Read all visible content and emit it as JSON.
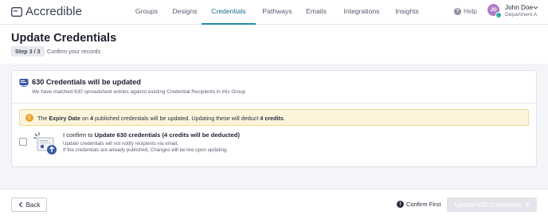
{
  "app": {
    "name": "Accredible"
  },
  "nav": {
    "items": [
      {
        "label": "Groups",
        "active": false
      },
      {
        "label": "Designs",
        "active": false
      },
      {
        "label": "Credentials",
        "active": true
      },
      {
        "label": "Pathways",
        "active": false
      },
      {
        "label": "Emails",
        "active": false
      },
      {
        "label": "Integrations",
        "active": false
      },
      {
        "label": "Insights",
        "active": false
      }
    ],
    "help": "Help"
  },
  "user": {
    "initials": "JD",
    "name": "John Doe",
    "department": "Department A"
  },
  "header": {
    "title": "Update Credentials",
    "step": "Step 3 / 3",
    "step_desc": "Confirm your records"
  },
  "card": {
    "title": "630 Credentials will be updated",
    "subtitle": "We have matched 630 spreadsheet entries against existing Credential Recipients in this Group"
  },
  "warning": {
    "t1": "The ",
    "field": "Expiry Date",
    "t2": " on ",
    "count": "4",
    "t3": " published credentials will be updated. Updating these will deduct ",
    "credits": "4 credits",
    "t4": "."
  },
  "confirm": {
    "prefix": "I confirm to ",
    "bold": "Update 630 credentials (4 credits will be deducted)",
    "line1": "Update credentials will not notify recipients via email,",
    "line2": "If the credentials are already published, Changes will be live upon updating.",
    "checked": false
  },
  "footer": {
    "back": "Back",
    "confirm_first": "Confirm First",
    "update": "Update 630 Credentials"
  },
  "colors": {
    "accent": "#1c8da6",
    "warning_bg": "#fdf4dc",
    "warning_icon": "#e8a92c",
    "disabled_btn": "#e3e5ea"
  }
}
